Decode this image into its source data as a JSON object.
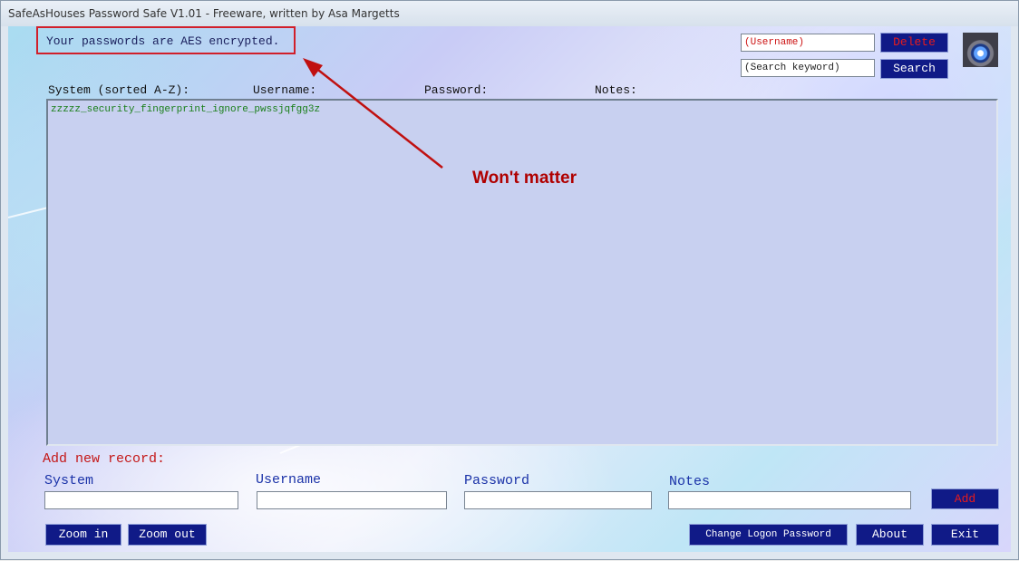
{
  "window": {
    "title": "SafeAsHouses Password Safe V1.01 - Freeware, written by Asa Margetts"
  },
  "header": {
    "encryption_notice": "Your passwords are AES encrypted.",
    "username_field_value": "(Username)",
    "delete_label": "Delete",
    "search_field_value": "(Search keyword)",
    "search_label": "Search"
  },
  "annotation": {
    "text": "Won't matter",
    "color": "#b00000"
  },
  "list": {
    "columns": [
      "System (sorted A-Z):",
      "Username:",
      "Password:",
      "Notes:"
    ],
    "items": [
      "zzzzz_security_fingerprint_ignore_pwssjqfgg3z"
    ]
  },
  "add_record": {
    "title": "Add new record:",
    "system_label": "System",
    "username_label": "Username",
    "password_label": "Password",
    "notes_label": "Notes",
    "add_label": "Add"
  },
  "footer": {
    "zoom_in_label": "Zoom in",
    "zoom_out_label": "Zoom out",
    "change_logon_label": "Change Logon Password",
    "about_label": "About",
    "exit_label": "Exit"
  },
  "colors": {
    "button_bg": "#101a87",
    "red_accent": "#d11f2a",
    "list_bg": "#c8d0f0"
  },
  "icons": {
    "logo": "eye-icon"
  }
}
